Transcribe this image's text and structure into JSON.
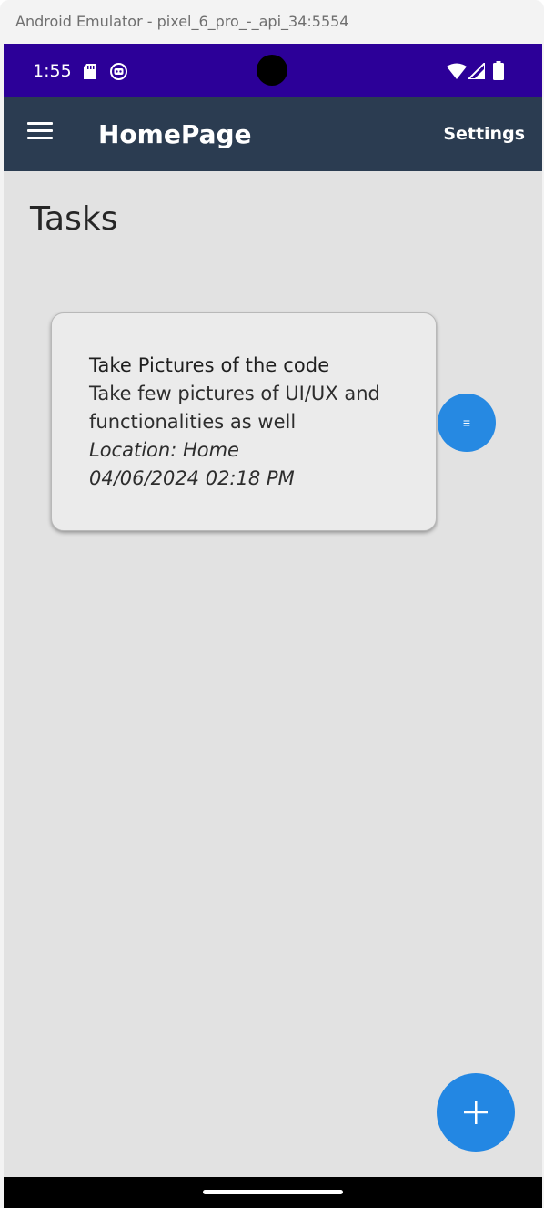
{
  "window": {
    "title": "Android Emulator - pixel_6_pro_-_api_34:5554"
  },
  "status_bar": {
    "time": "1:55",
    "icons": [
      "sd-card-icon",
      "robot-icon",
      "wifi-icon",
      "signal-icon",
      "battery-icon"
    ],
    "background": "#2c0098"
  },
  "app_bar": {
    "menu_icon": "hamburger-menu-icon",
    "title": "HomePage",
    "settings_label": "Settings",
    "background": "#2b3c51"
  },
  "page": {
    "title": "Tasks",
    "background": "#e2e2e2"
  },
  "tasks": [
    {
      "title": "Take Pictures of the code",
      "description_line1": "Take few pictures of UI/UX and",
      "description_line2": "functionalities as well",
      "location": "Location: Home",
      "datetime": "04/06/2024 02:18 PM",
      "action_label": "≡"
    }
  ],
  "fab": {
    "icon": "plus-icon",
    "color": "#2387e3"
  },
  "accent_color": "#2689e2"
}
